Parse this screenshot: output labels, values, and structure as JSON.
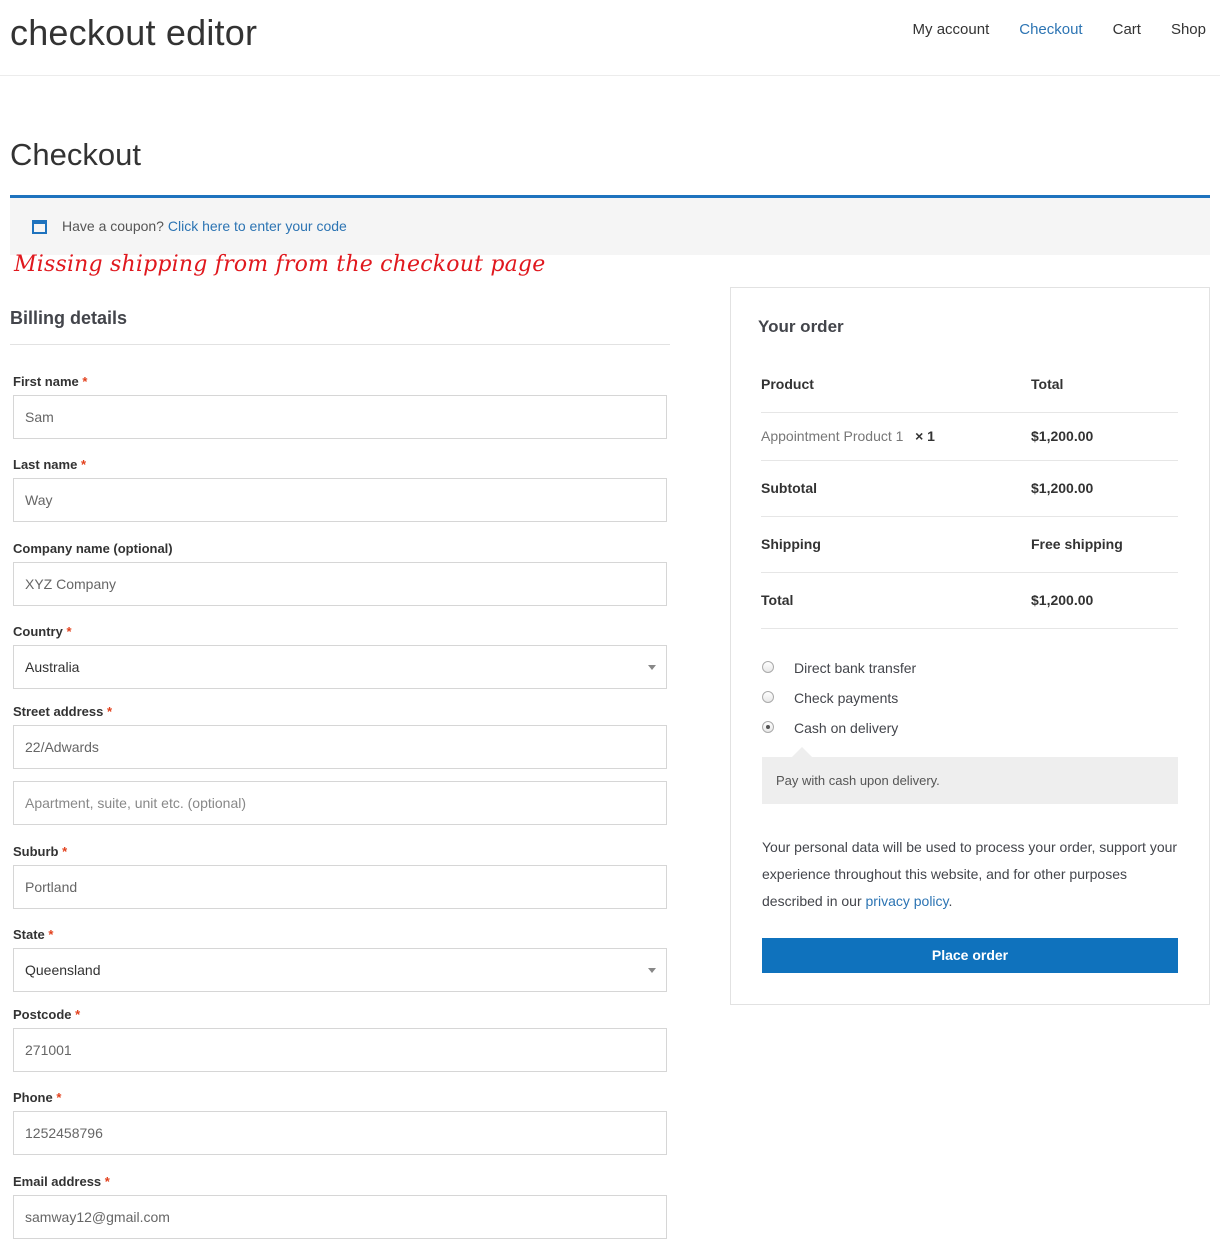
{
  "site": {
    "title": "checkout editor",
    "nav": [
      "My account",
      "Checkout",
      "Cart",
      "Shop"
    ]
  },
  "page_title": "Checkout",
  "coupon": {
    "prompt": "Have a coupon?",
    "link": "Click here to enter your code"
  },
  "annotation": "Missing shipping from from the checkout page",
  "billing": {
    "title": "Billing details",
    "required_mark": "*",
    "fields": {
      "first_name": {
        "label": "First name",
        "value": "Sam"
      },
      "last_name": {
        "label": "Last name",
        "value": "Way"
      },
      "company": {
        "label": "Company name (optional)",
        "value": "XYZ Company"
      },
      "country": {
        "label": "Country",
        "value": "Australia"
      },
      "street": {
        "label": "Street address",
        "value": "22/Adwards",
        "placeholder2": "Apartment, suite, unit etc. (optional)"
      },
      "suburb": {
        "label": "Suburb",
        "value": "Portland"
      },
      "state": {
        "label": "State",
        "value": "Queensland"
      },
      "postcode": {
        "label": "Postcode",
        "value": "271001"
      },
      "phone": {
        "label": "Phone",
        "value": "1252458796"
      },
      "email": {
        "label": "Email address",
        "value": "samway12@gmail.com"
      }
    }
  },
  "order": {
    "title": "Your order",
    "header": {
      "product": "Product",
      "total": "Total"
    },
    "item": {
      "name": "Appointment Product 1",
      "qty": "× 1",
      "total": "$1,200.00"
    },
    "subtotal": {
      "label": "Subtotal",
      "value": "$1,200.00"
    },
    "shipping": {
      "label": "Shipping",
      "value": "Free shipping"
    },
    "total": {
      "label": "Total",
      "value": "$1,200.00"
    },
    "payment_methods": [
      "Direct bank transfer",
      "Check payments",
      "Cash on delivery"
    ],
    "payment_selected": "Cash on delivery",
    "payment_description": "Pay with cash upon delivery.",
    "privacy_text": "Your personal data will be used to process your order, support your experience throughout this website, and for other purposes described in our",
    "privacy_link": "privacy policy",
    "privacy_end": ".",
    "place_order": "Place order"
  },
  "colors": {
    "accent": "#0f72bd",
    "link": "#2c74b3",
    "required": "#e2401c",
    "annotation": "#e0181e"
  }
}
